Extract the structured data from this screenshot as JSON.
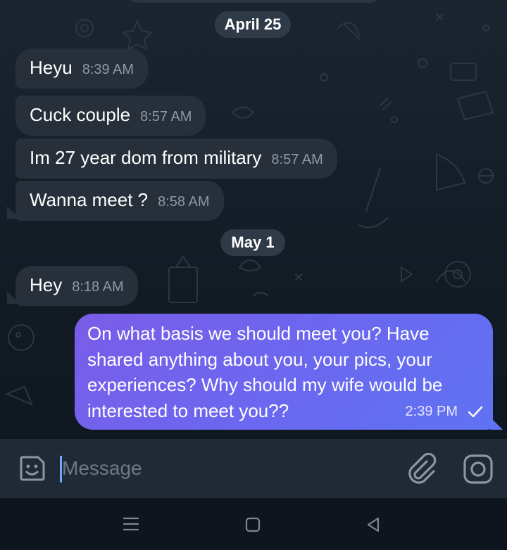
{
  "conversation": {
    "date_separators": [
      {
        "label": "April 25"
      },
      {
        "label": "May 1"
      }
    ],
    "incoming": [
      {
        "text": "Heyu",
        "time": "8:39 AM"
      },
      {
        "text": "Cuck couple",
        "time": "8:57 AM"
      },
      {
        "text": "Im 27 year dom from military",
        "time": "8:57 AM"
      },
      {
        "text": "Wanna meet ?",
        "time": "8:58 AM"
      },
      {
        "text": "Hey",
        "time": "8:18 AM"
      }
    ],
    "outgoing": {
      "lines": [
        "On what basis we should meet you? Have",
        "shared anything about you, your pics, your",
        "experiences? Why should my wife would be",
        "interested to meet you??"
      ],
      "time": "2:39 PM",
      "status_icon": "single-check-icon"
    }
  },
  "composer": {
    "placeholder": "Message",
    "icons": [
      "emoji-sticker-icon",
      "attach-paperclip-icon",
      "camera-icon"
    ]
  },
  "system_nav": {
    "icons": [
      "recents-menu-icon",
      "home-square-icon",
      "back-triangle-icon"
    ]
  },
  "colors": {
    "background": "#141d27",
    "incoming_bubble": "#262f3a",
    "outgoing_bubble": "#6a68f0",
    "date_pill": "#2e3a47",
    "input_bar": "#202a36",
    "navbar": "#0e151e"
  }
}
